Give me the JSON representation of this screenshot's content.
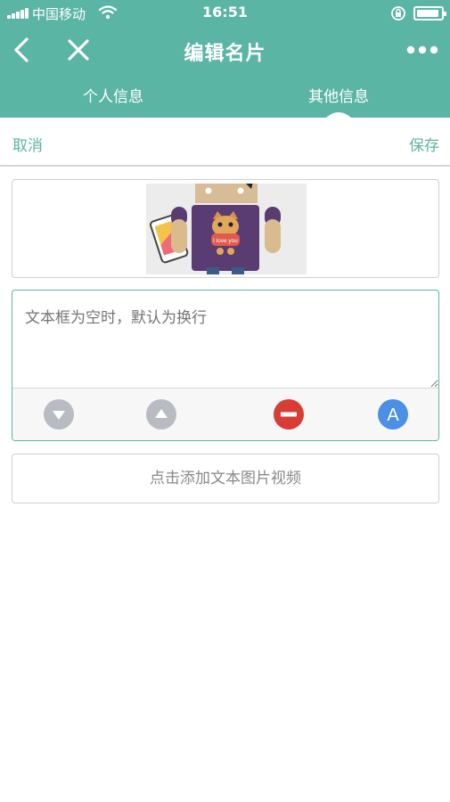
{
  "status_bar": {
    "carrier": "中国移动",
    "time": "16:51"
  },
  "nav": {
    "title": "编辑名片",
    "back_icon": "chevron-left-icon",
    "close_icon": "close-icon",
    "more_icon": "more-dots-icon"
  },
  "tabs": [
    {
      "label": "个人信息",
      "active": false
    },
    {
      "label": "其他信息",
      "active": true
    }
  ],
  "actions": {
    "cancel_label": "取消",
    "save_label": "保存"
  },
  "image_card": {
    "image_caption": "I love you"
  },
  "text_block": {
    "placeholder": "文本框为空时，默认为换行"
  },
  "tools": {
    "move_down_icon": "arrow-down-circle-icon",
    "move_up_icon": "arrow-up-circle-icon",
    "delete_icon": "minus-circle-icon",
    "font_icon": "font-a-icon",
    "font_letter": "A"
  },
  "add_button": {
    "label": "点击添加文本图片视频"
  },
  "colors": {
    "brand": "#5bb5a5",
    "delete": "#d83c35",
    "font": "#4b8fe6",
    "move": "#b8bcc2"
  }
}
